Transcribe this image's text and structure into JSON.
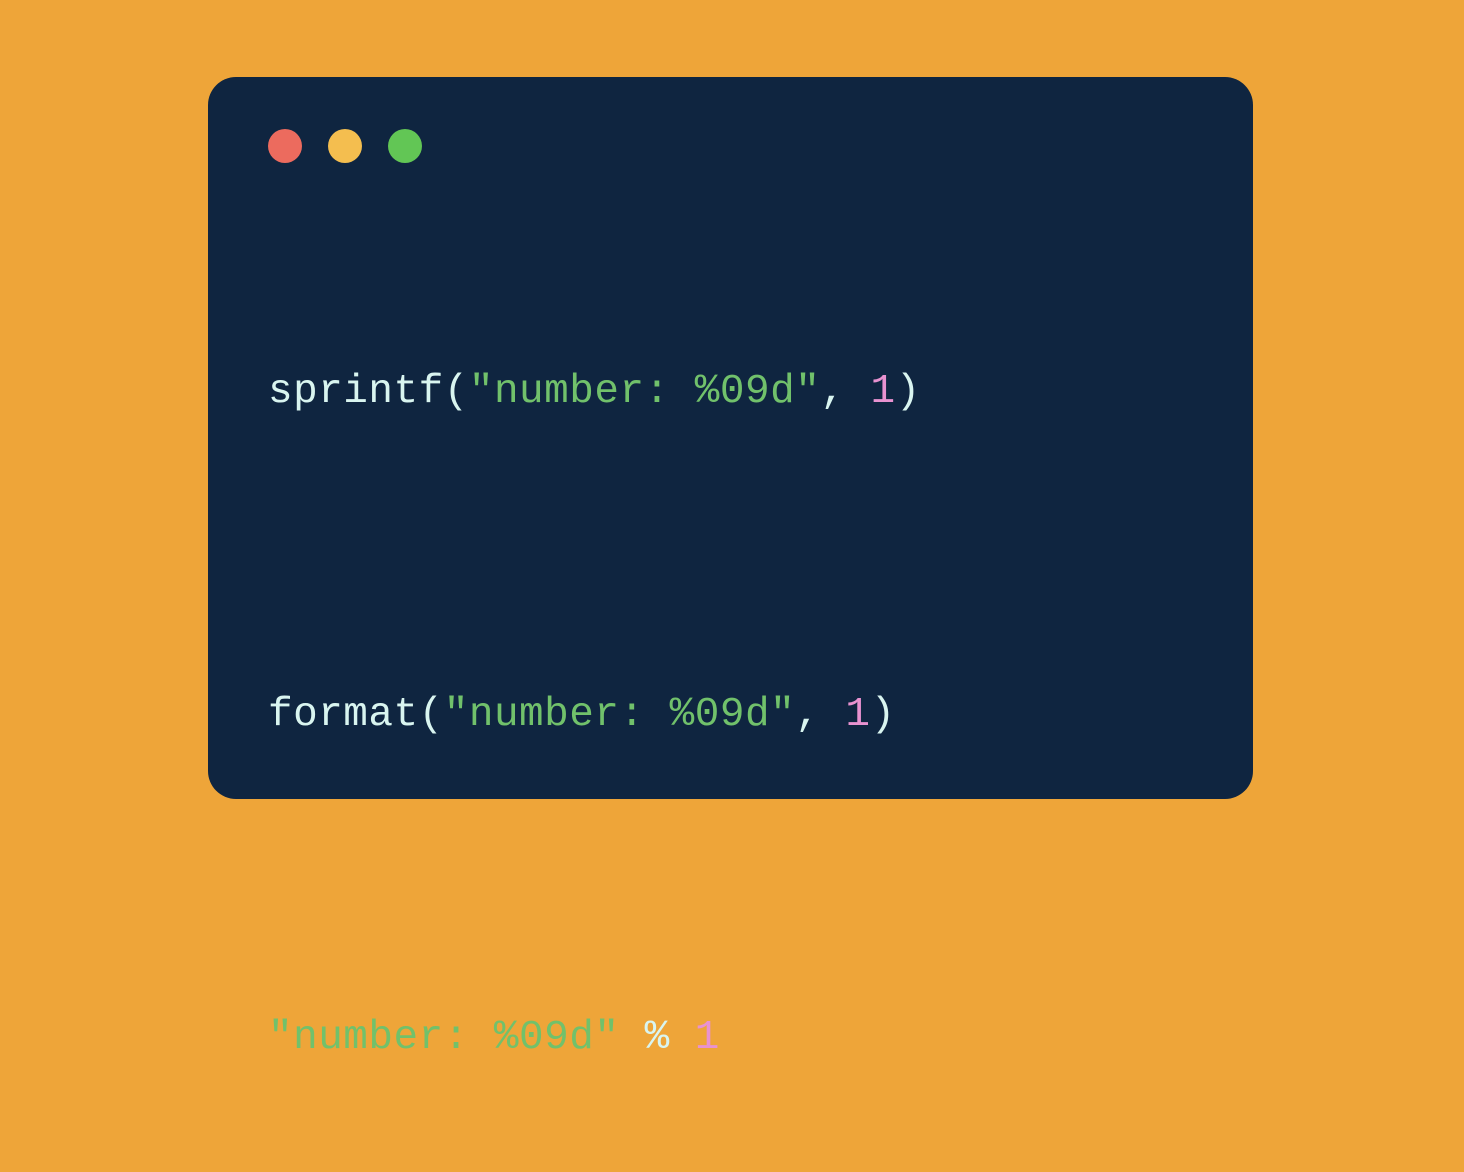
{
  "code": {
    "line1": {
      "fn": "sprintf",
      "open": "(",
      "str": "\"number: %09d\"",
      "comma": ",",
      "num": "1",
      "close": ")"
    },
    "line2": {
      "fn": "format",
      "open": "(",
      "str": "\"number: %09d\"",
      "comma": ",",
      "num": "1",
      "close": ")"
    },
    "line3": {
      "str": "\"number: %09d\"",
      "op": "%",
      "num": "1"
    }
  }
}
